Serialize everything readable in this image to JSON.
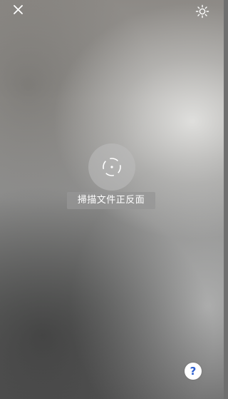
{
  "toolbar": {
    "close_icon": "close-icon",
    "brightness_icon": "brightness-icon"
  },
  "scanner": {
    "hint_text": "掃描文件正反面",
    "target_icon": "scan-target-icon"
  },
  "help": {
    "label": "?",
    "icon_color": "#2d5fd0"
  }
}
